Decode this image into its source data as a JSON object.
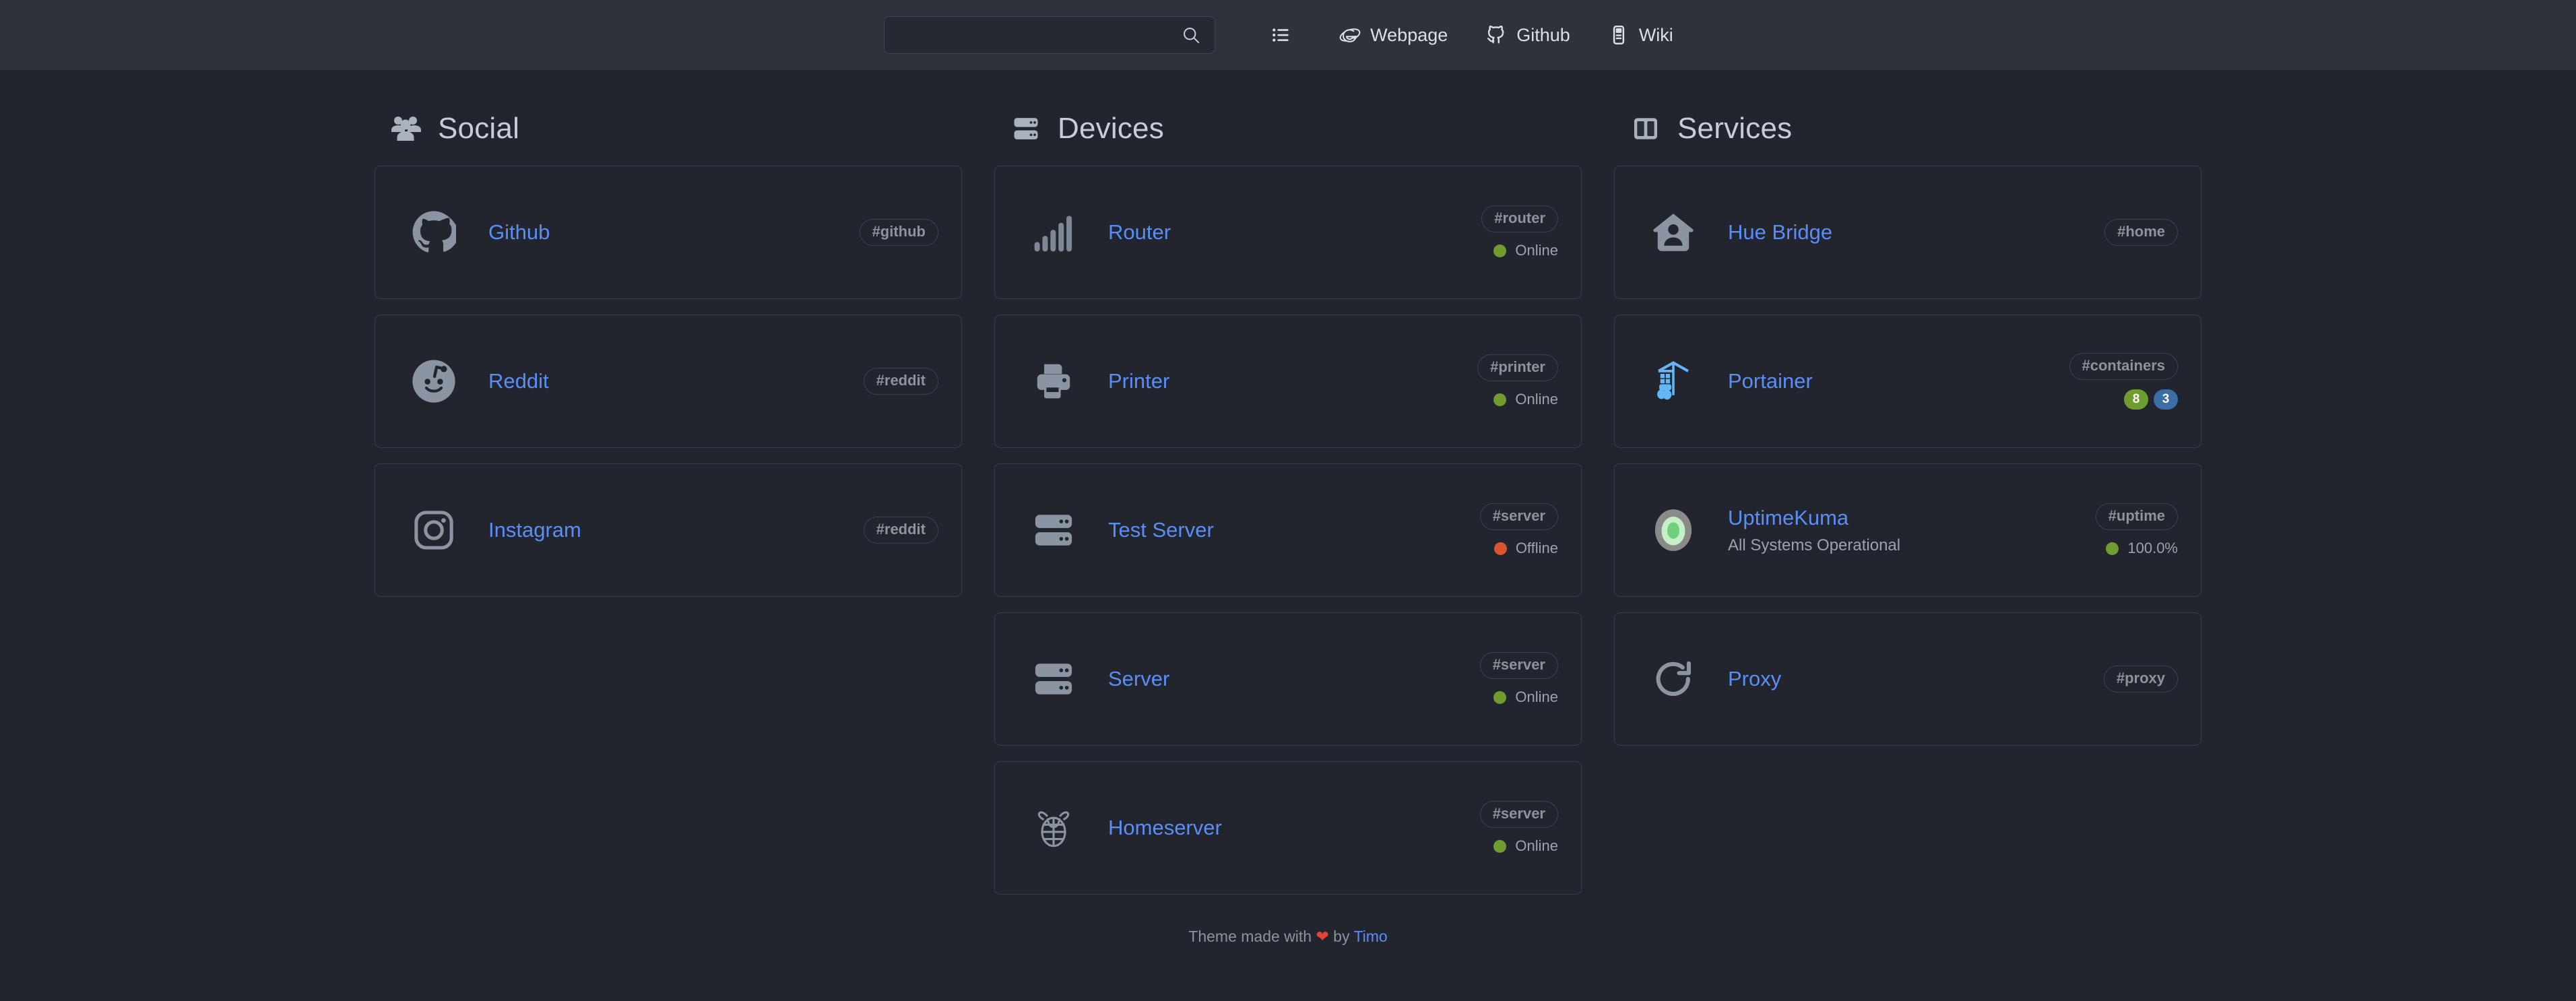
{
  "header": {
    "search": {
      "value": "",
      "placeholder": "",
      "icon": "search-icon"
    },
    "nav": [
      {
        "label": "",
        "icon": "list-icon"
      },
      {
        "label": "Webpage",
        "icon": "internet-explorer-icon"
      },
      {
        "label": "Github",
        "icon": "github-icon"
      },
      {
        "label": "Wiki",
        "icon": "book-icon"
      }
    ]
  },
  "colors": {
    "page_bg": "#22252e",
    "header_bg": "#2e323b",
    "card_border": "#373c46",
    "link": "#5a8ef7",
    "muted": "#9aa3b0",
    "online": "#6f9d2f",
    "offline": "#d9552f",
    "badge_green": "#6f9d2f",
    "badge_blue": "#3a6ea5",
    "heart": "#e8413a"
  },
  "columns": [
    {
      "title": "Social",
      "icon": "users-icon",
      "items": [
        {
          "name": "Github",
          "icon": "github-icon",
          "tag": "#github"
        },
        {
          "name": "Reddit",
          "icon": "reddit-icon",
          "tag": "#reddit"
        },
        {
          "name": "Instagram",
          "icon": "instagram-icon",
          "tag": "#reddit"
        }
      ]
    },
    {
      "title": "Devices",
      "icon": "server-icon",
      "items": [
        {
          "name": "Router",
          "icon": "signal-bars-icon",
          "tag": "#router",
          "status": "Online",
          "status_color": "#6f9d2f"
        },
        {
          "name": "Printer",
          "icon": "printer-icon",
          "tag": "#printer",
          "status": "Online",
          "status_color": "#6f9d2f"
        },
        {
          "name": "Test Server",
          "icon": "server-icon",
          "tag": "#server",
          "status": "Offline",
          "status_color": "#d9552f"
        },
        {
          "name": "Server",
          "icon": "server-icon",
          "tag": "#server",
          "status": "Online",
          "status_color": "#6f9d2f"
        },
        {
          "name": "Homeserver",
          "icon": "raspberry-pi-icon",
          "tag": "#server",
          "status": "Online",
          "status_color": "#6f9d2f"
        }
      ]
    },
    {
      "title": "Services",
      "icon": "columns-icon",
      "items": [
        {
          "name": "Hue Bridge",
          "icon": "home-person-icon",
          "tag": "#home"
        },
        {
          "name": "Portainer",
          "icon": "docker-icon",
          "tag": "#containers",
          "badges": [
            {
              "value": "8",
              "color": "#6f9d2f"
            },
            {
              "value": "3",
              "color": "#3a6ea5"
            }
          ]
        },
        {
          "name": "UptimeKuma",
          "icon": "uptimekuma-icon",
          "tag": "#uptime",
          "subtitle": "All Systems Operational",
          "status": "100.0%",
          "status_color": "#6f9d2f"
        },
        {
          "name": "Proxy",
          "icon": "refresh-icon",
          "tag": "#proxy"
        }
      ]
    }
  ],
  "footer": {
    "prefix": "Theme made with",
    "heart": "❤",
    "middle": "by",
    "author": "Timo"
  }
}
